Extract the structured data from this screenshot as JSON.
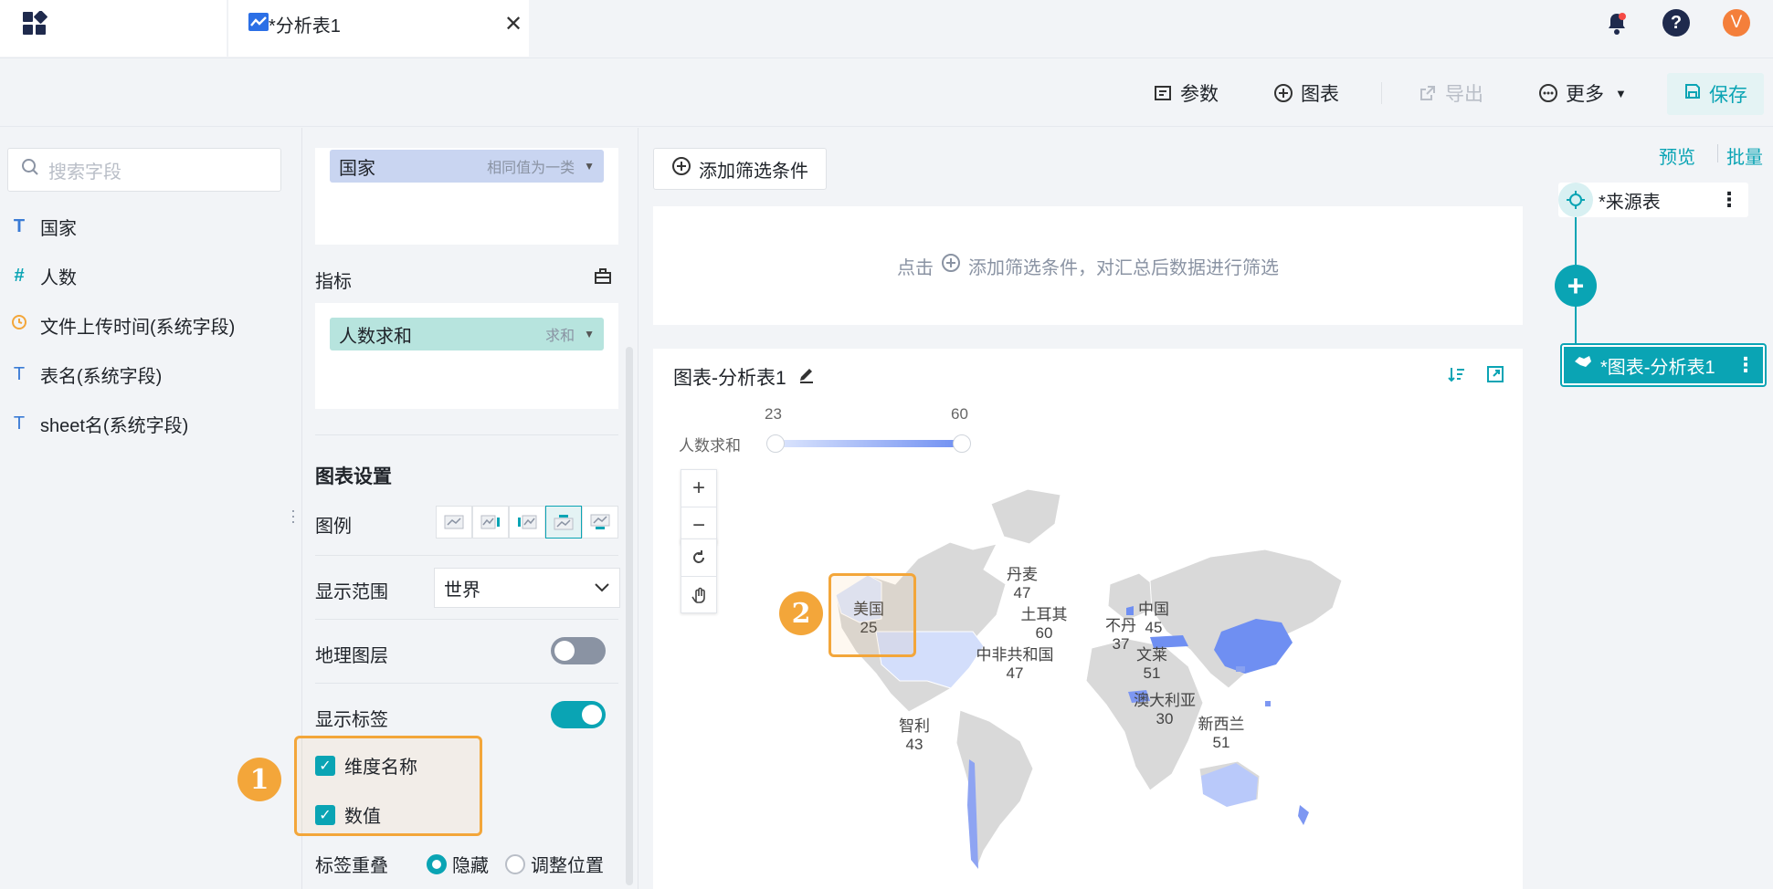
{
  "tabs": {
    "active_title": "*分析表1"
  },
  "header": {
    "user_initial": "V"
  },
  "toolbar": {
    "params_label": "参数",
    "chart_label": "图表",
    "export_label": "导出",
    "more_label": "更多",
    "save_label": "保存"
  },
  "fields": {
    "search_placeholder": "搜索字段",
    "items": [
      {
        "label": "国家",
        "icon": "text-dimension-icon"
      },
      {
        "label": "人数",
        "icon": "number-measure-icon"
      },
      {
        "label": "文件上传时间(系统字段)",
        "icon": "clock-icon"
      },
      {
        "label": "表名(系统字段)",
        "icon": "text-icon"
      },
      {
        "label": "sheet名(系统字段)",
        "icon": "text-icon"
      }
    ]
  },
  "config": {
    "dimension_pill": {
      "label": "国家",
      "sub": "相同值为一类"
    },
    "measure_section": "指标",
    "measure_pill": {
      "label": "人数求和",
      "sub": "求和"
    },
    "chart_settings_title": "图表设置",
    "legend_label": "图例",
    "range_label": "显示范围",
    "range_value": "世界",
    "geo_layer_label": "地理图层",
    "geo_layer_on": false,
    "show_labels_label": "显示标签",
    "show_labels_on": true,
    "dim_name_label": "维度名称",
    "value_label": "数值",
    "overlap_label": "标签重叠",
    "overlap_hide": "隐藏",
    "overlap_adjust": "调整位置",
    "overlap_selected": "隐藏"
  },
  "filter": {
    "add_label": "添加筛选条件",
    "hint_prefix": "点击",
    "hint_suffix": "添加筛选条件，对汇总后数据进行筛选"
  },
  "chart": {
    "title": "图表-分析表1",
    "legend_name": "人数求和",
    "legend_min": "23",
    "legend_max": "60"
  },
  "chart_data": {
    "type": "map",
    "region": "世界",
    "measure": "人数求和",
    "range": [
      23,
      60
    ],
    "points": [
      {
        "name": "美国",
        "value": "25"
      },
      {
        "name": "丹麦",
        "value": "47"
      },
      {
        "name": "土耳其",
        "value": "60"
      },
      {
        "name": "中国",
        "value": "45"
      },
      {
        "name": "不丹",
        "value": "37"
      },
      {
        "name": "中非共和国",
        "value": "47"
      },
      {
        "name": "文莱",
        "value": "51"
      },
      {
        "name": "澳大利亚",
        "value": "30"
      },
      {
        "name": "智利",
        "value": "43"
      },
      {
        "name": "新西兰",
        "value": "51"
      }
    ]
  },
  "flow": {
    "preview_label": "预览",
    "batch_label": "批量",
    "source_node": "*来源表",
    "chart_node": "*图表-分析表1"
  },
  "callouts": {
    "one": "1",
    "two": "2"
  },
  "colors": {
    "accent": "#0aa4b4",
    "callout": "#f3a63a",
    "map_high": "#6f8ff2",
    "map_low": "#d3defb"
  }
}
